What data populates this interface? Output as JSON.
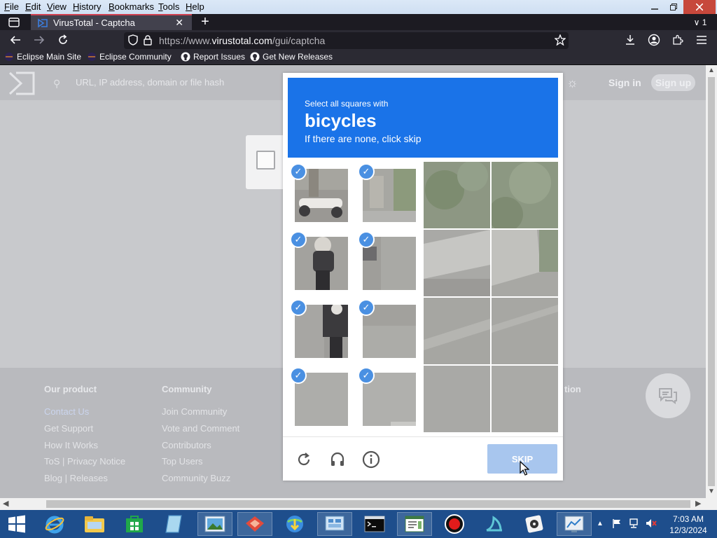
{
  "menu": [
    "File",
    "Edit",
    "View",
    "History",
    "Bookmarks",
    "Tools",
    "Help"
  ],
  "menu_underline": [
    "F",
    "E",
    "V",
    "H",
    "B",
    "T",
    "H"
  ],
  "window": {
    "tab_count": "1"
  },
  "tab": {
    "title": "VirusTotal - Captcha"
  },
  "url": {
    "prefix": "https://www.",
    "host": "virustotal.com",
    "path": "/gui/captcha"
  },
  "bookmarks": [
    {
      "label": "Eclipse Main Site",
      "icon": "eclipse-icon"
    },
    {
      "label": "Eclipse Community",
      "icon": "eclipse-icon"
    },
    {
      "label": "Report Issues",
      "icon": "github-icon"
    },
    {
      "label": "Get New Releases",
      "icon": "github-icon"
    }
  ],
  "vt": {
    "search_placeholder": "URL, IP address, domain or file hash",
    "sign_in": "Sign in",
    "sign_up": "Sign up"
  },
  "footer": {
    "columns": [
      {
        "heading": "Our product",
        "links": [
          "Contact Us",
          "Get Support",
          "How It Works",
          "ToS | Privacy Notice",
          "Blog | Releases"
        ]
      },
      {
        "heading": "Community",
        "links": [
          "Join Community",
          "Vote and Comment",
          "Contributors",
          "Top Users",
          "Community Buzz"
        ]
      }
    ],
    "partial_heading": "tion"
  },
  "captcha": {
    "instruction": "Select all squares with",
    "target": "bicycles",
    "hint": "If there are none, click skip",
    "skip_label": "SKIP",
    "selected_tiles": 8
  },
  "taskbar": {
    "time": "7:03 AM",
    "date": "12/3/2024"
  },
  "colors": {
    "banner": "#1a73e8",
    "check": "#4a90e2",
    "skip": "#a8c6ee",
    "taskbar": "#1e4e8c"
  }
}
